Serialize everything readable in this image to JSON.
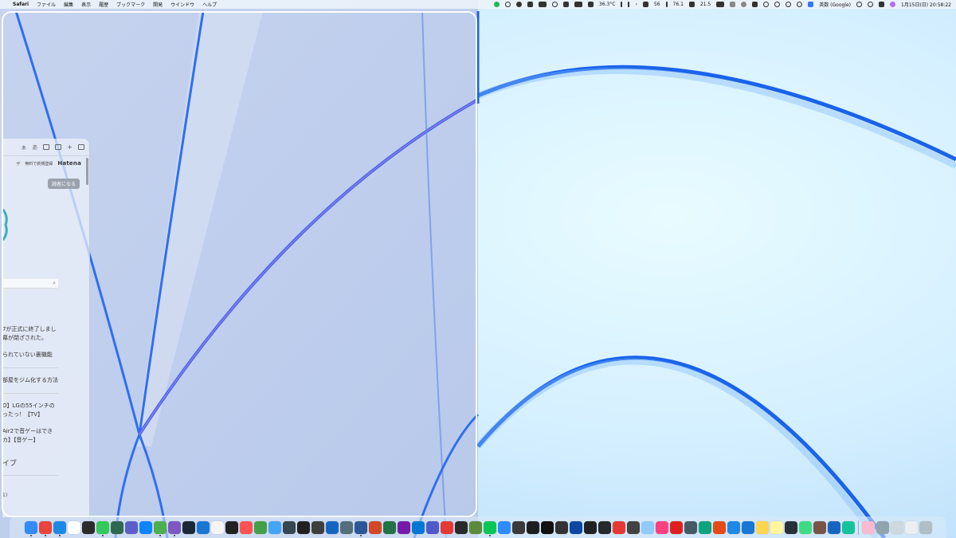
{
  "menubar": {
    "app_name": "Safari",
    "menus": [
      "ファイル",
      "編集",
      "表示",
      "履歴",
      "ブックマーク",
      "開発",
      "ウインドウ",
      "ヘルプ"
    ],
    "status": {
      "temperature": "36.3°C",
      "stat_1": "56",
      "stat_2": "76.1",
      "stat_3": "21.5",
      "input_source": "英数 (Google)",
      "datetime": "1月15日(日) 20:58:22"
    }
  },
  "safari": {
    "nav_signup": "無料で新規登録",
    "nav_cut": "ザ",
    "hatena_logo": "Hatena",
    "toolbar_text_1": "ぁ",
    "toolbar_text_2": "あ",
    "reader_button": "読者になる",
    "articles": [
      [
        "7が正式に終了しまし",
        "幕が閉ざされた。"
      ],
      [
        "られていない裏機能"
      ],
      [
        "部屋をジム化する方法"
      ],
      [
        "O】LGの55インチの",
        "ったっ！【TV】"
      ],
      [
        "Air2で音ゲーはでき",
        "カ】【音ゲー】"
      ]
    ],
    "section_title": "イブ",
    "small_text": "1)"
  },
  "dock": {
    "apps": [
      {
        "name": "finder",
        "color": "#2f8df5",
        "running": true
      },
      {
        "name": "chrome",
        "color": "#e8453c",
        "running": true
      },
      {
        "name": "safari",
        "color": "#1e88e5",
        "running": true
      },
      {
        "name": "notion",
        "color": "#ffffff",
        "running": false
      },
      {
        "name": "activity",
        "color": "#2c2c2c",
        "running": false
      },
      {
        "name": "messages",
        "color": "#34c759",
        "running": true
      },
      {
        "name": "facetime",
        "color": "#2d6a4f",
        "running": false
      },
      {
        "name": "ai-app",
        "color": "#5b5fc7",
        "running": false
      },
      {
        "name": "appstore",
        "color": "#0a84ff",
        "running": false
      },
      {
        "name": "terminal-like",
        "color": "#4caf50",
        "running": true
      },
      {
        "name": "vscode-purple",
        "color": "#7e57c2",
        "running": true
      },
      {
        "name": "steam",
        "color": "#1b2838",
        "running": false
      },
      {
        "name": "vscode",
        "color": "#1976d2",
        "running": false
      },
      {
        "name": "clock",
        "color": "#f5f5f5",
        "running": false
      },
      {
        "name": "monitor",
        "color": "#222222",
        "running": false
      },
      {
        "name": "launch",
        "color": "#ff5252",
        "running": false
      },
      {
        "name": "editor-green",
        "color": "#43a047",
        "running": false
      },
      {
        "name": "appstore-2",
        "color": "#42a5f5",
        "running": false
      },
      {
        "name": "tool-dark",
        "color": "#37474f",
        "running": false
      },
      {
        "name": "davinci",
        "color": "#212121",
        "running": false
      },
      {
        "name": "chatgpt",
        "color": "#3e3e3e",
        "running": false
      },
      {
        "name": "mu-app",
        "color": "#1565c0",
        "running": false
      },
      {
        "name": "finder-2",
        "color": "#546e7a",
        "running": false
      },
      {
        "name": "word-blue",
        "color": "#2b579a",
        "running": true
      },
      {
        "name": "powerpoint",
        "color": "#d24726",
        "running": false
      },
      {
        "name": "excel",
        "color": "#217346",
        "running": false
      },
      {
        "name": "onenote",
        "color": "#7719aa",
        "running": false
      },
      {
        "name": "outlook",
        "color": "#0078d4",
        "running": false
      },
      {
        "name": "teams",
        "color": "#5059c9",
        "running": false
      },
      {
        "name": "games",
        "color": "#e53935",
        "running": false
      },
      {
        "name": "epic",
        "color": "#2a2a2a",
        "running": false
      },
      {
        "name": "minecraft",
        "color": "#5d8a3a",
        "running": false
      },
      {
        "name": "line",
        "color": "#06c755",
        "running": true
      },
      {
        "name": "zoom",
        "color": "#2d8cff",
        "running": false
      },
      {
        "name": "calculator",
        "color": "#3a3a3a",
        "running": false
      },
      {
        "name": "figma",
        "color": "#1e1e1e",
        "running": false
      },
      {
        "name": "terminal",
        "color": "#111111",
        "running": false
      },
      {
        "name": "display",
        "color": "#333333",
        "running": false
      },
      {
        "name": "tv",
        "color": "#0d47a1",
        "running": false
      },
      {
        "name": "unity",
        "color": "#222222",
        "running": false
      },
      {
        "name": "github",
        "color": "#24292e",
        "running": false
      },
      {
        "name": "opera",
        "color": "#e53935",
        "running": false
      },
      {
        "name": "game-controller",
        "color": "#424242",
        "running": false
      },
      {
        "name": "preview",
        "color": "#90caf9",
        "running": false
      },
      {
        "name": "jetbrains",
        "color": "#ff4081",
        "running": false
      },
      {
        "name": "acrobat",
        "color": "#e02020",
        "running": false
      },
      {
        "name": "mouse-app",
        "color": "#455a64",
        "running": false
      },
      {
        "name": "chatgpt-2",
        "color": "#10a37f",
        "running": false
      },
      {
        "name": "sketch",
        "color": "#e64a19",
        "running": false
      },
      {
        "name": "bento",
        "color": "#1e88e5",
        "running": false
      },
      {
        "name": "xcode",
        "color": "#1976d2",
        "running": false
      },
      {
        "name": "notes",
        "color": "#ffd54f",
        "running": false
      },
      {
        "name": "stickies",
        "color": "#fff59d",
        "running": false
      },
      {
        "name": "terminal-2",
        "color": "#263238",
        "running": false
      },
      {
        "name": "android",
        "color": "#3ddc84",
        "running": false
      },
      {
        "name": "crate",
        "color": "#795548",
        "running": false
      },
      {
        "name": "todo",
        "color": "#1565c0",
        "running": false
      },
      {
        "name": "grammarly",
        "color": "#15c39a",
        "running": false
      },
      {
        "name": "sep",
        "color": "",
        "running": false
      },
      {
        "name": "avatar",
        "color": "#f8bbd0",
        "running": false
      },
      {
        "name": "folder-1",
        "color": "#90a4ae",
        "running": false
      },
      {
        "name": "folder-2",
        "color": "#cfd8dc",
        "running": false
      },
      {
        "name": "doc",
        "color": "#eceff1",
        "running": false
      },
      {
        "name": "trash",
        "color": "#b0bec5",
        "running": false
      }
    ]
  }
}
